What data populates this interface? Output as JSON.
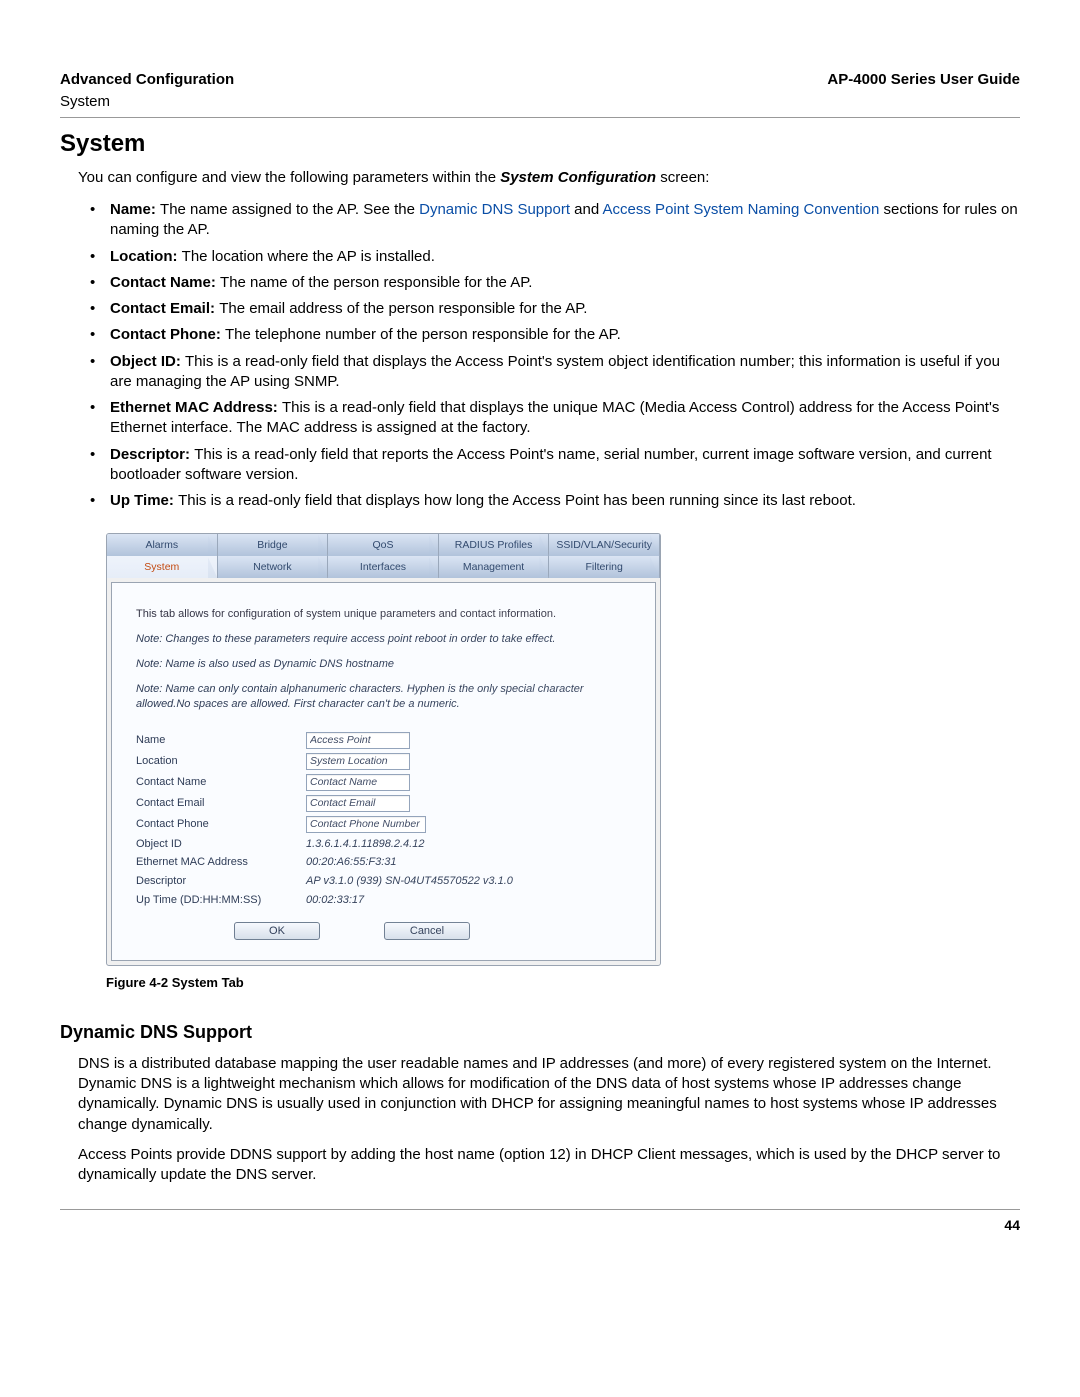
{
  "header": {
    "left": "Advanced Configuration",
    "right": "AP-4000 Series User Guide",
    "sub": "System"
  },
  "section_title": "System",
  "intro_prefix": "You can configure and view the following parameters within the ",
  "intro_bold": "System Configuration",
  "intro_suffix": " screen:",
  "bullets": [
    {
      "pre": "Name: ",
      "text_start": "The name assigned to the AP. See the ",
      "link1": "Dynamic DNS Support",
      "mid": " and ",
      "link2": "Access Point System Naming Convention",
      "text_end": " sections for rules on naming the AP."
    },
    {
      "pre": "Location: ",
      "text": "The location where the AP is installed."
    },
    {
      "pre": "Contact Name: ",
      "text": "The name of the person responsible for the AP."
    },
    {
      "pre": "Contact Email: ",
      "text": "The email address of the person responsible for the AP."
    },
    {
      "pre": "Contact Phone: ",
      "text": "The telephone number of the person responsible for the AP."
    },
    {
      "pre": "Object ID: ",
      "text": "This is a read-only field that displays the Access Point's system object identification number; this information is useful if you are managing the AP using SNMP."
    },
    {
      "pre": "Ethernet MAC Address: ",
      "text": "This is a read-only field that displays the unique MAC (Media Access Control) address for the Access Point's Ethernet interface. The MAC address is assigned at the factory."
    },
    {
      "pre": "Descriptor: ",
      "text": "This is a read-only field that reports the Access Point's name, serial number, current image software version, and current bootloader software version."
    },
    {
      "pre": "Up Time: ",
      "text": "This is a read-only field that displays how long the Access Point has been running since its last reboot."
    }
  ],
  "screenshot": {
    "tabs_top": [
      "Alarms",
      "Bridge",
      "QoS",
      "RADIUS Profiles",
      "SSID/VLAN/Security"
    ],
    "tabs_bottom": [
      "System",
      "Network",
      "Interfaces",
      "Management",
      "Filtering"
    ],
    "active_tab": "System",
    "description": "This tab allows for configuration of system unique parameters and contact information.",
    "note1": "Note: Changes to these parameters require access point reboot in order to take effect.",
    "note2": "Note: Name is also used as Dynamic DNS hostname",
    "note3": "Note: Name can only contain alphanumeric characters. Hyphen is the only special character allowed.No spaces are allowed. First character can't be a numeric.",
    "fields": {
      "name_label": "Name",
      "name_value": "Access Point",
      "location_label": "Location",
      "location_value": "System Location",
      "contact_name_label": "Contact Name",
      "contact_name_value": "Contact Name",
      "contact_email_label": "Contact Email",
      "contact_email_value": "Contact Email",
      "contact_phone_label": "Contact Phone",
      "contact_phone_value": "Contact Phone Number",
      "object_id_label": "Object ID",
      "object_id_value": "1.3.6.1.4.1.11898.2.4.12",
      "mac_label": "Ethernet MAC Address",
      "mac_value": "00:20:A6:55:F3:31",
      "descriptor_label": "Descriptor",
      "descriptor_value": "AP v3.1.0 (939) SN-04UT45570522 v3.1.0",
      "uptime_label": "Up Time (DD:HH:MM:SS)",
      "uptime_value": "00:02:33:17"
    },
    "ok_label": "OK",
    "cancel_label": "Cancel"
  },
  "figure_caption": "Figure 4-2 System Tab",
  "ddns_title": "Dynamic DNS Support",
  "ddns_p1": "DNS is a distributed database mapping the user readable names and IP addresses (and more) of every registered system on the Internet. Dynamic DNS is a lightweight mechanism which allows for modification of the DNS data of host systems whose IP addresses change dynamically. Dynamic DNS is usually used in conjunction with DHCP for assigning meaningful names to host systems whose IP addresses change dynamically.",
  "ddns_p2": "Access Points provide DDNS support by adding the host name (option 12) in DHCP Client messages, which is used by the DHCP server to dynamically update the DNS server.",
  "page_number": "44"
}
